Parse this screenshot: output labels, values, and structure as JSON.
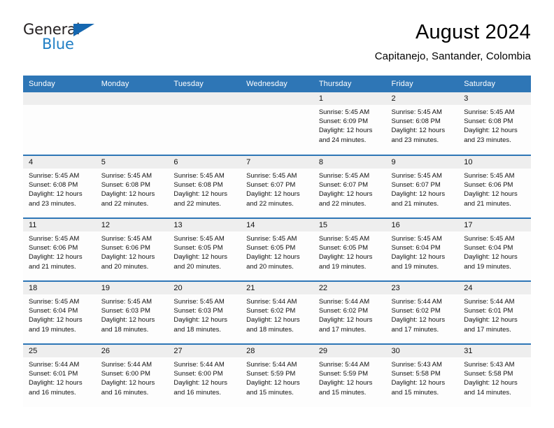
{
  "brand": {
    "name_part1": "General",
    "name_part2": "Blue",
    "mark_icon": "triangle-logo-icon"
  },
  "header": {
    "title": "August 2024",
    "location": "Capitanejo, Santander, Colombia"
  },
  "colors": {
    "header_blue": "#2e76b6",
    "brand_blue": "#1f7ec4",
    "daynum_band": "#eeeeee",
    "cell_bg": "#fdfdfd"
  },
  "weekday_headers": [
    "Sunday",
    "Monday",
    "Tuesday",
    "Wednesday",
    "Thursday",
    "Friday",
    "Saturday"
  ],
  "weeks": [
    [
      {
        "day": "",
        "empty": true,
        "sunrise": "",
        "sunset": "",
        "daylight_line1": "",
        "daylight_line2": ""
      },
      {
        "day": "",
        "empty": true,
        "sunrise": "",
        "sunset": "",
        "daylight_line1": "",
        "daylight_line2": ""
      },
      {
        "day": "",
        "empty": true,
        "sunrise": "",
        "sunset": "",
        "daylight_line1": "",
        "daylight_line2": ""
      },
      {
        "day": "",
        "empty": true,
        "sunrise": "",
        "sunset": "",
        "daylight_line1": "",
        "daylight_line2": ""
      },
      {
        "day": "1",
        "empty": false,
        "sunrise": "Sunrise: 5:45 AM",
        "sunset": "Sunset: 6:09 PM",
        "daylight_line1": "Daylight: 12 hours",
        "daylight_line2": "and 24 minutes."
      },
      {
        "day": "2",
        "empty": false,
        "sunrise": "Sunrise: 5:45 AM",
        "sunset": "Sunset: 6:08 PM",
        "daylight_line1": "Daylight: 12 hours",
        "daylight_line2": "and 23 minutes."
      },
      {
        "day": "3",
        "empty": false,
        "sunrise": "Sunrise: 5:45 AM",
        "sunset": "Sunset: 6:08 PM",
        "daylight_line1": "Daylight: 12 hours",
        "daylight_line2": "and 23 minutes."
      }
    ],
    [
      {
        "day": "4",
        "empty": false,
        "sunrise": "Sunrise: 5:45 AM",
        "sunset": "Sunset: 6:08 PM",
        "daylight_line1": "Daylight: 12 hours",
        "daylight_line2": "and 23 minutes."
      },
      {
        "day": "5",
        "empty": false,
        "sunrise": "Sunrise: 5:45 AM",
        "sunset": "Sunset: 6:08 PM",
        "daylight_line1": "Daylight: 12 hours",
        "daylight_line2": "and 22 minutes."
      },
      {
        "day": "6",
        "empty": false,
        "sunrise": "Sunrise: 5:45 AM",
        "sunset": "Sunset: 6:08 PM",
        "daylight_line1": "Daylight: 12 hours",
        "daylight_line2": "and 22 minutes."
      },
      {
        "day": "7",
        "empty": false,
        "sunrise": "Sunrise: 5:45 AM",
        "sunset": "Sunset: 6:07 PM",
        "daylight_line1": "Daylight: 12 hours",
        "daylight_line2": "and 22 minutes."
      },
      {
        "day": "8",
        "empty": false,
        "sunrise": "Sunrise: 5:45 AM",
        "sunset": "Sunset: 6:07 PM",
        "daylight_line1": "Daylight: 12 hours",
        "daylight_line2": "and 22 minutes."
      },
      {
        "day": "9",
        "empty": false,
        "sunrise": "Sunrise: 5:45 AM",
        "sunset": "Sunset: 6:07 PM",
        "daylight_line1": "Daylight: 12 hours",
        "daylight_line2": "and 21 minutes."
      },
      {
        "day": "10",
        "empty": false,
        "sunrise": "Sunrise: 5:45 AM",
        "sunset": "Sunset: 6:06 PM",
        "daylight_line1": "Daylight: 12 hours",
        "daylight_line2": "and 21 minutes."
      }
    ],
    [
      {
        "day": "11",
        "empty": false,
        "sunrise": "Sunrise: 5:45 AM",
        "sunset": "Sunset: 6:06 PM",
        "daylight_line1": "Daylight: 12 hours",
        "daylight_line2": "and 21 minutes."
      },
      {
        "day": "12",
        "empty": false,
        "sunrise": "Sunrise: 5:45 AM",
        "sunset": "Sunset: 6:06 PM",
        "daylight_line1": "Daylight: 12 hours",
        "daylight_line2": "and 20 minutes."
      },
      {
        "day": "13",
        "empty": false,
        "sunrise": "Sunrise: 5:45 AM",
        "sunset": "Sunset: 6:05 PM",
        "daylight_line1": "Daylight: 12 hours",
        "daylight_line2": "and 20 minutes."
      },
      {
        "day": "14",
        "empty": false,
        "sunrise": "Sunrise: 5:45 AM",
        "sunset": "Sunset: 6:05 PM",
        "daylight_line1": "Daylight: 12 hours",
        "daylight_line2": "and 20 minutes."
      },
      {
        "day": "15",
        "empty": false,
        "sunrise": "Sunrise: 5:45 AM",
        "sunset": "Sunset: 6:05 PM",
        "daylight_line1": "Daylight: 12 hours",
        "daylight_line2": "and 19 minutes."
      },
      {
        "day": "16",
        "empty": false,
        "sunrise": "Sunrise: 5:45 AM",
        "sunset": "Sunset: 6:04 PM",
        "daylight_line1": "Daylight: 12 hours",
        "daylight_line2": "and 19 minutes."
      },
      {
        "day": "17",
        "empty": false,
        "sunrise": "Sunrise: 5:45 AM",
        "sunset": "Sunset: 6:04 PM",
        "daylight_line1": "Daylight: 12 hours",
        "daylight_line2": "and 19 minutes."
      }
    ],
    [
      {
        "day": "18",
        "empty": false,
        "sunrise": "Sunrise: 5:45 AM",
        "sunset": "Sunset: 6:04 PM",
        "daylight_line1": "Daylight: 12 hours",
        "daylight_line2": "and 19 minutes."
      },
      {
        "day": "19",
        "empty": false,
        "sunrise": "Sunrise: 5:45 AM",
        "sunset": "Sunset: 6:03 PM",
        "daylight_line1": "Daylight: 12 hours",
        "daylight_line2": "and 18 minutes."
      },
      {
        "day": "20",
        "empty": false,
        "sunrise": "Sunrise: 5:45 AM",
        "sunset": "Sunset: 6:03 PM",
        "daylight_line1": "Daylight: 12 hours",
        "daylight_line2": "and 18 minutes."
      },
      {
        "day": "21",
        "empty": false,
        "sunrise": "Sunrise: 5:44 AM",
        "sunset": "Sunset: 6:02 PM",
        "daylight_line1": "Daylight: 12 hours",
        "daylight_line2": "and 18 minutes."
      },
      {
        "day": "22",
        "empty": false,
        "sunrise": "Sunrise: 5:44 AM",
        "sunset": "Sunset: 6:02 PM",
        "daylight_line1": "Daylight: 12 hours",
        "daylight_line2": "and 17 minutes."
      },
      {
        "day": "23",
        "empty": false,
        "sunrise": "Sunrise: 5:44 AM",
        "sunset": "Sunset: 6:02 PM",
        "daylight_line1": "Daylight: 12 hours",
        "daylight_line2": "and 17 minutes."
      },
      {
        "day": "24",
        "empty": false,
        "sunrise": "Sunrise: 5:44 AM",
        "sunset": "Sunset: 6:01 PM",
        "daylight_line1": "Daylight: 12 hours",
        "daylight_line2": "and 17 minutes."
      }
    ],
    [
      {
        "day": "25",
        "empty": false,
        "sunrise": "Sunrise: 5:44 AM",
        "sunset": "Sunset: 6:01 PM",
        "daylight_line1": "Daylight: 12 hours",
        "daylight_line2": "and 16 minutes."
      },
      {
        "day": "26",
        "empty": false,
        "sunrise": "Sunrise: 5:44 AM",
        "sunset": "Sunset: 6:00 PM",
        "daylight_line1": "Daylight: 12 hours",
        "daylight_line2": "and 16 minutes."
      },
      {
        "day": "27",
        "empty": false,
        "sunrise": "Sunrise: 5:44 AM",
        "sunset": "Sunset: 6:00 PM",
        "daylight_line1": "Daylight: 12 hours",
        "daylight_line2": "and 16 minutes."
      },
      {
        "day": "28",
        "empty": false,
        "sunrise": "Sunrise: 5:44 AM",
        "sunset": "Sunset: 5:59 PM",
        "daylight_line1": "Daylight: 12 hours",
        "daylight_line2": "and 15 minutes."
      },
      {
        "day": "29",
        "empty": false,
        "sunrise": "Sunrise: 5:44 AM",
        "sunset": "Sunset: 5:59 PM",
        "daylight_line1": "Daylight: 12 hours",
        "daylight_line2": "and 15 minutes."
      },
      {
        "day": "30",
        "empty": false,
        "sunrise": "Sunrise: 5:43 AM",
        "sunset": "Sunset: 5:58 PM",
        "daylight_line1": "Daylight: 12 hours",
        "daylight_line2": "and 15 minutes."
      },
      {
        "day": "31",
        "empty": false,
        "sunrise": "Sunrise: 5:43 AM",
        "sunset": "Sunset: 5:58 PM",
        "daylight_line1": "Daylight: 12 hours",
        "daylight_line2": "and 14 minutes."
      }
    ]
  ]
}
